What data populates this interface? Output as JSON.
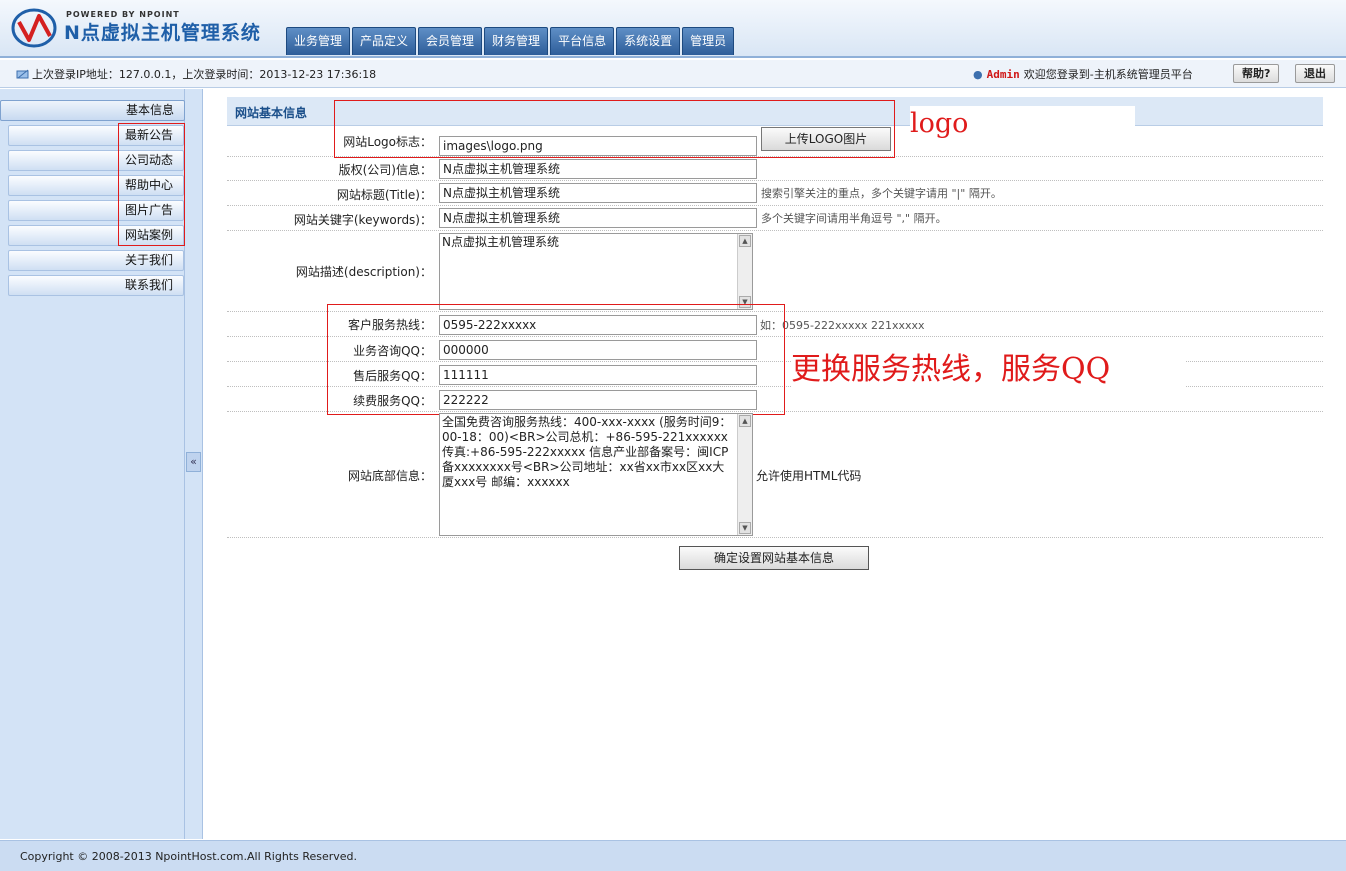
{
  "header": {
    "powered": "POWERED BY NPOINT",
    "title": "N点虚拟主机管理系统",
    "nav": [
      "业务管理",
      "产品定义",
      "会员管理",
      "财务管理",
      "平台信息",
      "系统设置",
      "管理员"
    ]
  },
  "infobar": {
    "login_info": "上次登录IP地址：127.0.0.1，上次登录时间：2013-12-23 17:36:18",
    "admin": "Admin",
    "welcome": "欢迎您登录到-主机系统管理员平台",
    "help": "帮助?",
    "logout": "退出"
  },
  "sidebar": {
    "items": [
      "基本信息",
      "最新公告",
      "公司动态",
      "帮助中心",
      "图片广告",
      "网站案例",
      "关于我们",
      "联系我们"
    ],
    "collapse": "«"
  },
  "panel": {
    "title": "网站基本信息",
    "fields": {
      "logo": {
        "label": "网站Logo标志：",
        "value": "images\\logo.png",
        "upload": "上传LOGO图片"
      },
      "copyright": {
        "label": "版权(公司)信息：",
        "value": "N点虚拟主机管理系统"
      },
      "site_title": {
        "label": "网站标题(Title)：",
        "value": "N点虚拟主机管理系统",
        "hint": "搜索引擎关注的重点，多个关键字请用 \"|\" 隔开。"
      },
      "keywords": {
        "label": "网站关键字(keywords)：",
        "value": "N点虚拟主机管理系统",
        "hint": "多个关键字间请用半角逗号 \",\" 隔开。"
      },
      "description": {
        "label": "网站描述(description)：",
        "value": "N点虚拟主机管理系统"
      },
      "hotline": {
        "label": "客户服务热线：",
        "value": "0595-222xxxxx",
        "hint": "如：0595-222xxxxx 221xxxxx"
      },
      "qq_consult": {
        "label": "业务咨询QQ：",
        "value": "000000"
      },
      "qq_after": {
        "label": "售后服务QQ：",
        "value": "111111"
      },
      "qq_renew": {
        "label": "续费服务QQ：",
        "value": "222222"
      },
      "footer_info": {
        "label": "网站底部信息：",
        "value": "全国免费咨询服务热线：400-xxx-xxxx (服务时间9：00-18：00)<BR>公司总机：+86-595-221xxxxxx 传真:+86-595-222xxxxx 信息产业部备案号：闽ICP备xxxxxxxx号<BR>公司地址：xx省xx市xx区xx大厦xxx号 邮编：xxxxxx",
        "hint": "允许使用HTML代码"
      }
    },
    "submit": "确定设置网站基本信息"
  },
  "annotations": {
    "logo": "logo",
    "service": "更换服务热线，服务QQ"
  },
  "footer": "Copyright © 2008-2013 NpointHost.com.All Rights Reserved."
}
